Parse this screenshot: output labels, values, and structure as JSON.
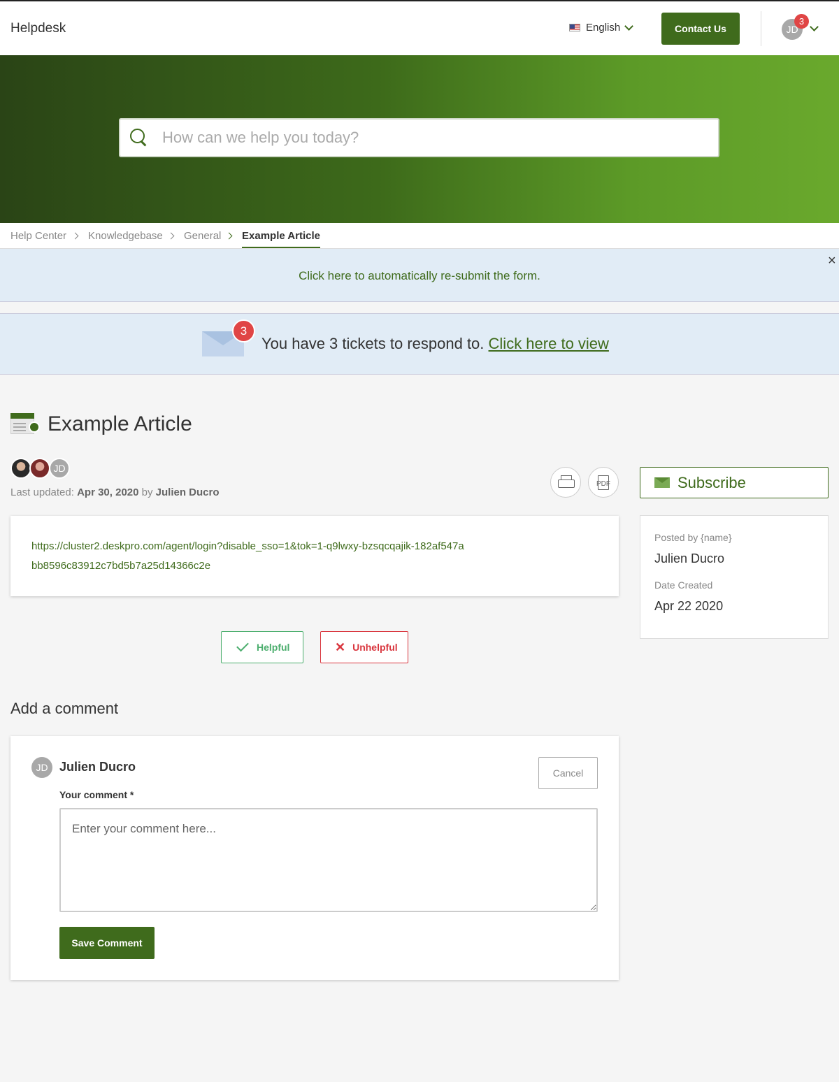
{
  "header": {
    "brand": "Helpdesk",
    "language": "English",
    "contact_label": "Contact Us",
    "user_initials": "JD",
    "notification_count": "3"
  },
  "search": {
    "placeholder": "How can we help you today?"
  },
  "breadcrumb": {
    "items": [
      "Help Center",
      "Knowledgebase",
      "General",
      "Example Article"
    ]
  },
  "notice": {
    "text": "Click here to automatically re-submit the form.",
    "close": "×"
  },
  "tickets": {
    "count": "3",
    "text": "You have 3 tickets to respond to.",
    "link": "Click here to view"
  },
  "article": {
    "title": "Example Article",
    "author_initials": "JD",
    "updated_prefix": "Last updated:",
    "updated_date": "Apr 30, 2020",
    "updated_by": "by",
    "updated_author": "Julien Ducro",
    "pdf_label": "PDF",
    "subscribe": "Subscribe",
    "body_link": "https://cluster2.deskpro.com/agent/login?disable_sso=1&tok=1-q9lwxy-bzsqcqajik-182af547abb8596c83912c7bd5b7a25d14366c2e"
  },
  "sidebar": {
    "posted_by_label": "Posted by {name}",
    "posted_by": "Julien Ducro",
    "date_label": "Date Created",
    "date": "Apr 22 2020"
  },
  "feedback": {
    "helpful": "Helpful",
    "unhelpful": "Unhelpful",
    "x_glyph": "✕"
  },
  "comment": {
    "heading": "Add a comment",
    "user_initials": "JD",
    "user_name": "Julien Ducro",
    "cancel": "Cancel",
    "label": "Your comment *",
    "placeholder": "Enter your comment here...",
    "save": "Save Comment"
  },
  "colors": {
    "accent": "#3f6b1c",
    "badge": "#e04545",
    "helpful": "#4cae6e",
    "unhelpful": "#d9363e",
    "notice_bg": "#e1ecf6"
  }
}
